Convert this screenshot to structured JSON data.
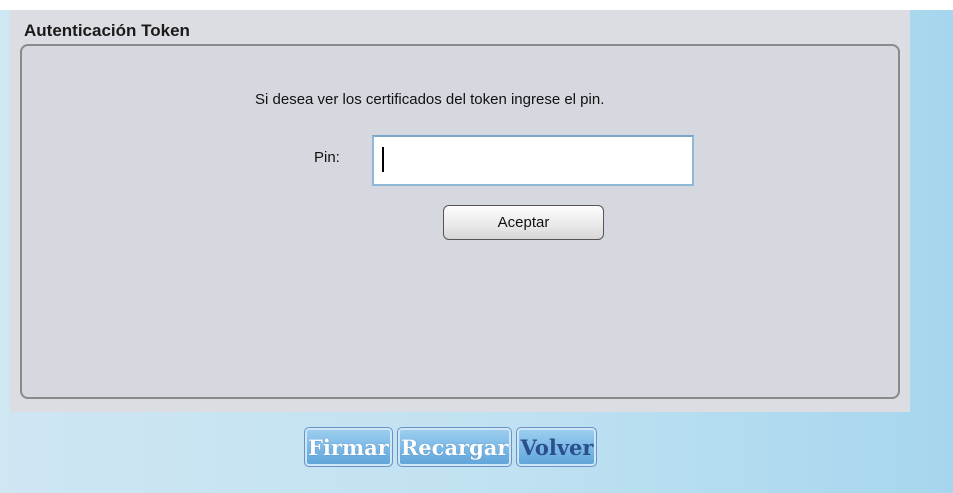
{
  "dialog": {
    "title": "Autenticación Token",
    "instruction": "Si desea ver los certificados del token ingrese el pin.",
    "pin_label": "Pin:",
    "pin_value": "",
    "accept_label": "Aceptar"
  },
  "actions": {
    "sign_label": "Firmar",
    "reload_label": "Recargar",
    "back_label": "Volver"
  },
  "colors": {
    "page_background": "#bfe1f1",
    "dialog_background": "#dcdde2",
    "action_button": "#78b8e6",
    "active_action_text": "#2b4f8a"
  }
}
